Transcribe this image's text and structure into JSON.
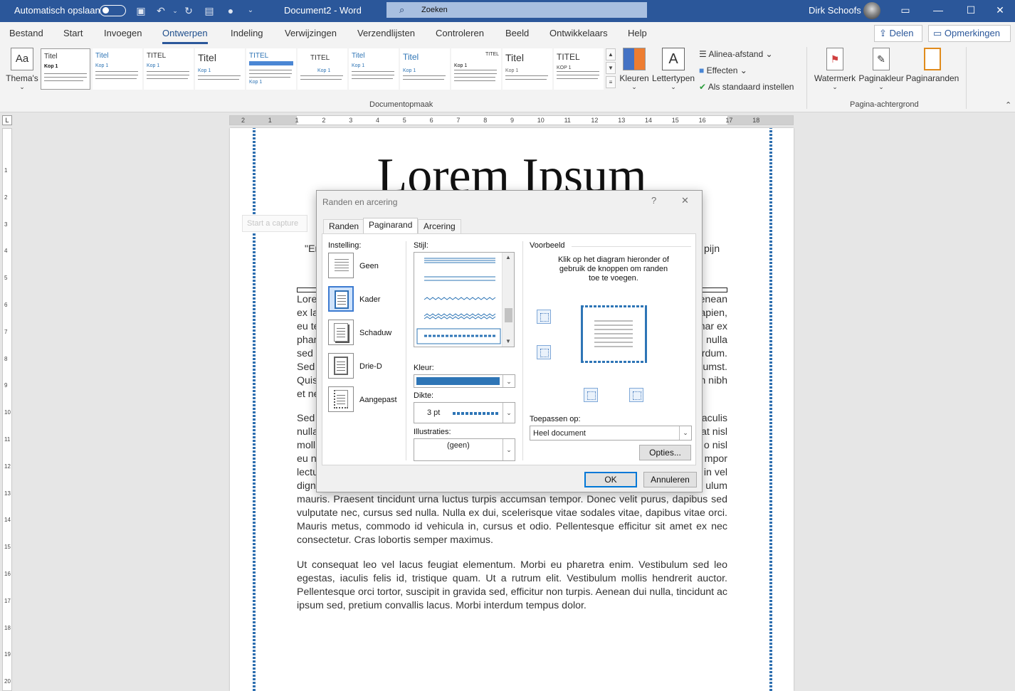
{
  "titlebar": {
    "autosave_label": "Automatisch opslaan",
    "doc_title": "Document2  -  Word",
    "search_placeholder": "Zoeken",
    "user_name": "Dirk Schoofs",
    "accent_color": "#2b579a"
  },
  "menu": {
    "items": [
      "Bestand",
      "Start",
      "Invoegen",
      "Ontwerpen",
      "Indeling",
      "Verwijzingen",
      "Verzendlijsten",
      "Controleren",
      "Beeld",
      "Ontwikkelaars",
      "Help"
    ],
    "active": "Ontwerpen",
    "share_label": "Delen",
    "comments_label": "Opmerkingen"
  },
  "ribbon": {
    "themes_label": "Thema's",
    "gallery": [
      {
        "title": "Titel",
        "heading": "Kop 1"
      },
      {
        "title": "Titel",
        "heading": "Kop 1"
      },
      {
        "title": "TITEL",
        "heading": "Kop 1"
      },
      {
        "title": "Titel",
        "heading": "Kop 1"
      },
      {
        "title": "TITEL",
        "heading": "Kop 1"
      },
      {
        "title": "TITEL",
        "heading": "Kop 1"
      },
      {
        "title": "Titel",
        "heading": "Kop 1"
      },
      {
        "title": "Titel",
        "heading": "Kop 1"
      },
      {
        "title": "TITEL",
        "heading": "Kop 1"
      },
      {
        "title": "Titel",
        "heading": "Kop 1"
      },
      {
        "title": "TITEL",
        "heading": "KOP 1"
      }
    ],
    "colors_label": "Kleuren",
    "fonts_label": "Lettertypen",
    "spacing_label": "Alinea-afstand",
    "effects_label": "Effecten",
    "default_label": "Als standaard instellen",
    "group_doc_format": "Documentopmaak",
    "watermark_label": "Watermerk",
    "pagecolor_label": "Paginakleur",
    "pageborders_label": "Paginaranden",
    "group_page_bg": "Pagina-achtergrond"
  },
  "ruler": {
    "ruler_corner": "L",
    "h_ticks": [
      "2",
      "1",
      "1",
      "2",
      "3",
      "4",
      "5",
      "6",
      "7",
      "8",
      "9",
      "10",
      "11",
      "12",
      "13",
      "14",
      "15",
      "16",
      "17",
      "18"
    ],
    "v_ticks": [
      "1",
      "2",
      "3",
      "4",
      "5",
      "6",
      "7",
      "8",
      "9",
      "10",
      "11",
      "12",
      "13",
      "14",
      "15",
      "16",
      "17",
      "18",
      "19",
      "20"
    ]
  },
  "document": {
    "title": "Lorem Ipsum",
    "capture_label": "Start a capture",
    "quote_start": "\"Er",
    "quote_end": "pijn",
    "left_fragments": [
      "Lore",
      "ex la",
      "eu te",
      "phar",
      "sed",
      "Sed",
      "Quis",
      "et ne"
    ],
    "right_fragments": [
      "enean",
      "apien,",
      "nar ex",
      "nulla",
      "rdum.",
      "umst.",
      "n nibh"
    ],
    "left_fragments2": [
      "Sed",
      "nulla",
      "moll",
      "eu n",
      "lectu",
      "dign"
    ],
    "right_fragments2": [
      "aculis",
      "at nisl",
      "o nisl",
      "mpor",
      "in vel",
      "ulum"
    ],
    "para2_tail": "mauris. Praesent tincidunt urna luctus turpis accumsan tempor. Donec velit purus, dapibus sed vulputate nec, cursus sed nulla. Nulla ex dui, scelerisque vitae sodales vitae, dapibus vitae orci. Mauris metus, commodo id vehicula in, cursus et odio. Pellentesque efficitur sit amet ex nec consectetur. Cras lobortis semper maximus.",
    "para3": "Ut consequat leo vel lacus feugiat elementum. Morbi eu pharetra enim. Vestibulum sed leo egestas, iaculis felis id, tristique quam. Ut a rutrum elit. Vestibulum mollis hendrerit auctor. Pellentesque orci tortor, suscipit in gravida sed, efficitur non turpis. Aenean dui nulla, tincidunt ac ipsum sed, pretium convallis lacus. Morbi interdum tempus dolor."
  },
  "dialog": {
    "title": "Randen en arcering",
    "help": "?",
    "close": "✕",
    "tabs": [
      "Randen",
      "Paginarand",
      "Arcering"
    ],
    "active_tab": "Paginarand",
    "setting_label": "Instelling:",
    "settings": [
      "Geen",
      "Kader",
      "Schaduw",
      "Drie-D",
      "Aangepast"
    ],
    "selected_setting": "Kader",
    "style_label": "Stijl:",
    "color_label": "Kleur:",
    "color_value": "#2e75b6",
    "width_label": "Dikte:",
    "width_value": "3 pt",
    "art_label": "Illustraties:",
    "art_value": "(geen)",
    "preview_label": "Voorbeeld",
    "preview_hint": "Klik op het diagram hieronder of gebruik de knoppen om randen toe te voegen.",
    "apply_label": "Toepassen op:",
    "apply_value": "Heel document",
    "options_button": "Opties...",
    "ok_button": "OK",
    "cancel_button": "Annuleren"
  }
}
